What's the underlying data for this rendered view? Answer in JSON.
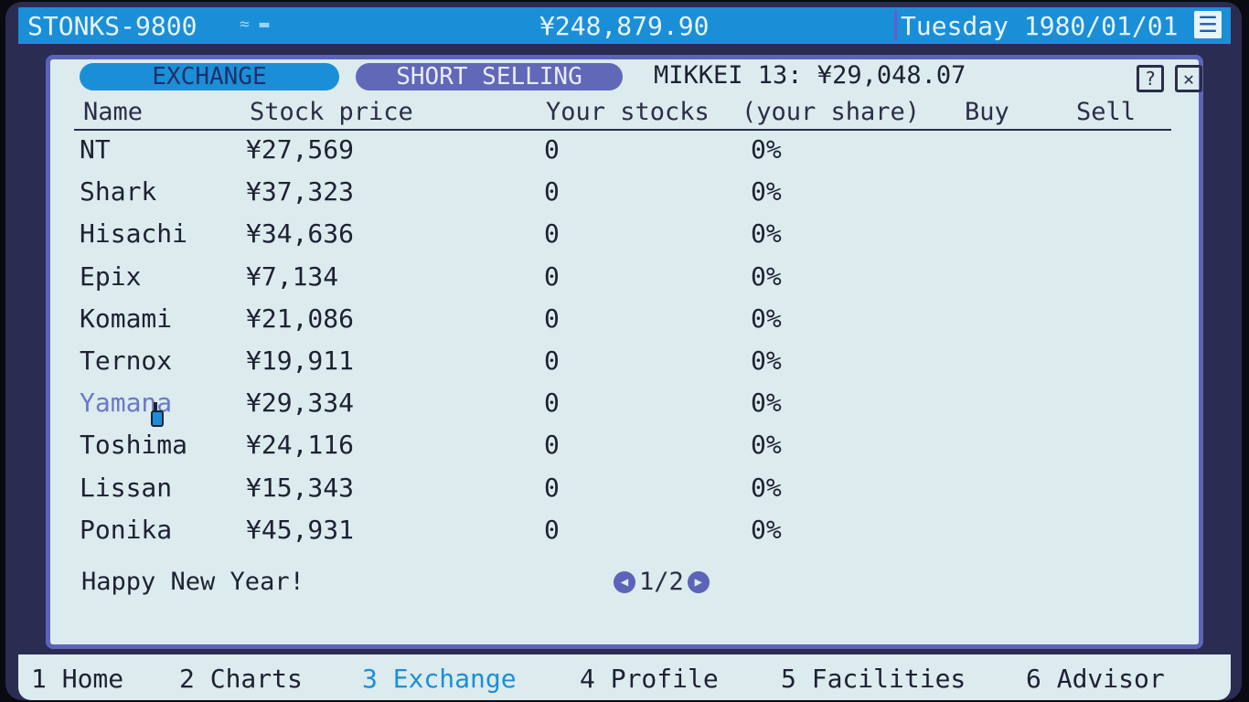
{
  "topbar": {
    "title": "STONKS-9800",
    "signal": "≈ ▬",
    "money": "¥248,879.90",
    "date": "Tuesday 1980/01/01",
    "menu_glyph": "☰"
  },
  "window": {
    "tabs": [
      {
        "label": "EXCHANGE"
      },
      {
        "label": "SHORT SELLING"
      }
    ],
    "index_label": "MIKKEI 13: ¥29,048.07",
    "help_glyph": "?",
    "close_glyph": "✕"
  },
  "table": {
    "headers": {
      "name": "Name",
      "price": "Stock price",
      "stocks": "Your stocks",
      "share": "(your share)",
      "buy": "Buy",
      "sell": "Sell"
    },
    "rows": [
      {
        "name": "NT",
        "price": "¥27,569",
        "stocks": "0",
        "share": "0%"
      },
      {
        "name": "Shark",
        "price": "¥37,323",
        "stocks": "0",
        "share": "0%"
      },
      {
        "name": "Hisachi",
        "price": "¥34,636",
        "stocks": "0",
        "share": "0%"
      },
      {
        "name": "Epix",
        "price": "¥7,134",
        "stocks": "0",
        "share": "0%"
      },
      {
        "name": "Komami",
        "price": "¥21,086",
        "stocks": "0",
        "share": "0%"
      },
      {
        "name": "Ternox",
        "price": "¥19,911",
        "stocks": "0",
        "share": "0%"
      },
      {
        "name": "Yamana",
        "price": "¥29,334",
        "stocks": "0",
        "share": "0%"
      },
      {
        "name": "Toshima",
        "price": "¥24,116",
        "stocks": "0",
        "share": "0%"
      },
      {
        "name": "Lissan",
        "price": "¥15,343",
        "stocks": "0",
        "share": "0%"
      },
      {
        "name": "Ponika",
        "price": "¥45,931",
        "stocks": "0",
        "share": "0%"
      }
    ]
  },
  "footer": {
    "message": "Happy New Year!",
    "page": "1/2",
    "prev_glyph": "◀",
    "next_glyph": "▶"
  },
  "nav": [
    {
      "label": "1 Home"
    },
    {
      "label": "2 Charts"
    },
    {
      "label": "3 Exchange"
    },
    {
      "label": "4 Profile"
    },
    {
      "label": "5 Facilities"
    },
    {
      "label": "6 Advisor"
    }
  ],
  "colors": {
    "accent": "#1a8fd8",
    "secondary": "#6268b8",
    "panel": "#dcebee",
    "hover_text": "#6a78c8"
  }
}
